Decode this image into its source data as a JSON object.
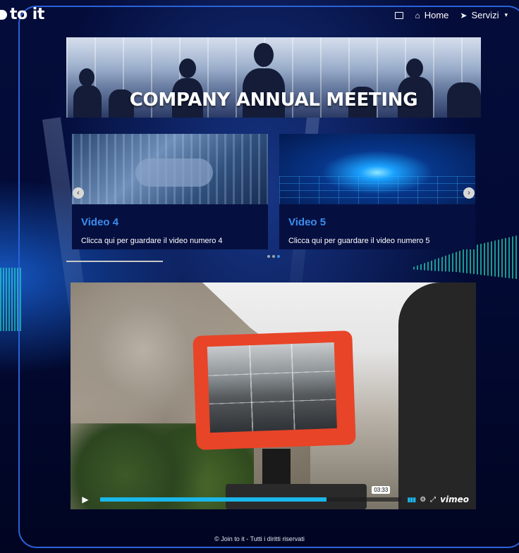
{
  "header": {
    "logo_text": "to it",
    "nav": [
      {
        "label": "",
        "icon": "tv-icon"
      },
      {
        "label": "Home",
        "icon": "home-icon"
      },
      {
        "label": "Servizi",
        "icon": "compass-icon"
      }
    ]
  },
  "banner": {
    "title": "COMPANY ANNUAL MEETING"
  },
  "carousel": {
    "cards": [
      {
        "title": "Video 4",
        "description": "Clicca qui per guardare il video numero 4"
      },
      {
        "title": "Video 5",
        "description": "Clicca qui per guardare il video numero 5"
      }
    ],
    "dot_count": 3,
    "active_dot": 2
  },
  "video": {
    "time": "03:33",
    "progress": 0.75,
    "brand": "vimeo"
  },
  "footer": {
    "text": "© Join to it - Tutti i diritti riservati"
  },
  "colors": {
    "accent": "#3b8ef0",
    "frame": "#2a62d8",
    "vimeo_blue": "#1ab7ea",
    "monitor": "#e84428"
  }
}
